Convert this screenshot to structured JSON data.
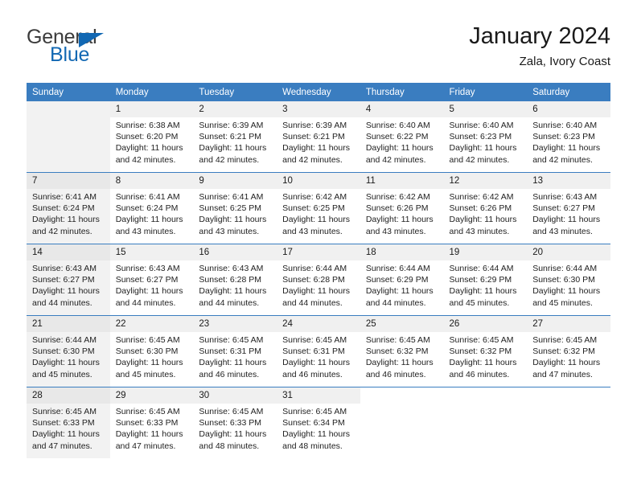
{
  "brand": {
    "name_part1": "General",
    "name_part2": "Blue",
    "triangle_color": "#1268b3",
    "text_color": "#3b3b3b"
  },
  "header": {
    "title": "January 2024",
    "subtitle": "Zala, Ivory Coast"
  },
  "theme": {
    "header_bg": "#3a7dc0",
    "header_text": "#ffffff",
    "daynum_bg": "#f0f0f0",
    "sunday_bg": "#f2f2f2",
    "grid_line": "#3a7dc0"
  },
  "weekdays": [
    "Sunday",
    "Monday",
    "Tuesday",
    "Wednesday",
    "Thursday",
    "Friday",
    "Saturday"
  ],
  "weeks": [
    [
      {
        "day": "",
        "sunrise": "",
        "sunset": "",
        "daylight_line1": "",
        "daylight_line2": ""
      },
      {
        "day": "1",
        "sunrise": "Sunrise: 6:38 AM",
        "sunset": "Sunset: 6:20 PM",
        "daylight_line1": "Daylight: 11 hours",
        "daylight_line2": "and 42 minutes."
      },
      {
        "day": "2",
        "sunrise": "Sunrise: 6:39 AM",
        "sunset": "Sunset: 6:21 PM",
        "daylight_line1": "Daylight: 11 hours",
        "daylight_line2": "and 42 minutes."
      },
      {
        "day": "3",
        "sunrise": "Sunrise: 6:39 AM",
        "sunset": "Sunset: 6:21 PM",
        "daylight_line1": "Daylight: 11 hours",
        "daylight_line2": "and 42 minutes."
      },
      {
        "day": "4",
        "sunrise": "Sunrise: 6:40 AM",
        "sunset": "Sunset: 6:22 PM",
        "daylight_line1": "Daylight: 11 hours",
        "daylight_line2": "and 42 minutes."
      },
      {
        "day": "5",
        "sunrise": "Sunrise: 6:40 AM",
        "sunset": "Sunset: 6:23 PM",
        "daylight_line1": "Daylight: 11 hours",
        "daylight_line2": "and 42 minutes."
      },
      {
        "day": "6",
        "sunrise": "Sunrise: 6:40 AM",
        "sunset": "Sunset: 6:23 PM",
        "daylight_line1": "Daylight: 11 hours",
        "daylight_line2": "and 42 minutes."
      }
    ],
    [
      {
        "day": "7",
        "sunrise": "Sunrise: 6:41 AM",
        "sunset": "Sunset: 6:24 PM",
        "daylight_line1": "Daylight: 11 hours",
        "daylight_line2": "and 42 minutes."
      },
      {
        "day": "8",
        "sunrise": "Sunrise: 6:41 AM",
        "sunset": "Sunset: 6:24 PM",
        "daylight_line1": "Daylight: 11 hours",
        "daylight_line2": "and 43 minutes."
      },
      {
        "day": "9",
        "sunrise": "Sunrise: 6:41 AM",
        "sunset": "Sunset: 6:25 PM",
        "daylight_line1": "Daylight: 11 hours",
        "daylight_line2": "and 43 minutes."
      },
      {
        "day": "10",
        "sunrise": "Sunrise: 6:42 AM",
        "sunset": "Sunset: 6:25 PM",
        "daylight_line1": "Daylight: 11 hours",
        "daylight_line2": "and 43 minutes."
      },
      {
        "day": "11",
        "sunrise": "Sunrise: 6:42 AM",
        "sunset": "Sunset: 6:26 PM",
        "daylight_line1": "Daylight: 11 hours",
        "daylight_line2": "and 43 minutes."
      },
      {
        "day": "12",
        "sunrise": "Sunrise: 6:42 AM",
        "sunset": "Sunset: 6:26 PM",
        "daylight_line1": "Daylight: 11 hours",
        "daylight_line2": "and 43 minutes."
      },
      {
        "day": "13",
        "sunrise": "Sunrise: 6:43 AM",
        "sunset": "Sunset: 6:27 PM",
        "daylight_line1": "Daylight: 11 hours",
        "daylight_line2": "and 43 minutes."
      }
    ],
    [
      {
        "day": "14",
        "sunrise": "Sunrise: 6:43 AM",
        "sunset": "Sunset: 6:27 PM",
        "daylight_line1": "Daylight: 11 hours",
        "daylight_line2": "and 44 minutes."
      },
      {
        "day": "15",
        "sunrise": "Sunrise: 6:43 AM",
        "sunset": "Sunset: 6:27 PM",
        "daylight_line1": "Daylight: 11 hours",
        "daylight_line2": "and 44 minutes."
      },
      {
        "day": "16",
        "sunrise": "Sunrise: 6:43 AM",
        "sunset": "Sunset: 6:28 PM",
        "daylight_line1": "Daylight: 11 hours",
        "daylight_line2": "and 44 minutes."
      },
      {
        "day": "17",
        "sunrise": "Sunrise: 6:44 AM",
        "sunset": "Sunset: 6:28 PM",
        "daylight_line1": "Daylight: 11 hours",
        "daylight_line2": "and 44 minutes."
      },
      {
        "day": "18",
        "sunrise": "Sunrise: 6:44 AM",
        "sunset": "Sunset: 6:29 PM",
        "daylight_line1": "Daylight: 11 hours",
        "daylight_line2": "and 44 minutes."
      },
      {
        "day": "19",
        "sunrise": "Sunrise: 6:44 AM",
        "sunset": "Sunset: 6:29 PM",
        "daylight_line1": "Daylight: 11 hours",
        "daylight_line2": "and 45 minutes."
      },
      {
        "day": "20",
        "sunrise": "Sunrise: 6:44 AM",
        "sunset": "Sunset: 6:30 PM",
        "daylight_line1": "Daylight: 11 hours",
        "daylight_line2": "and 45 minutes."
      }
    ],
    [
      {
        "day": "21",
        "sunrise": "Sunrise: 6:44 AM",
        "sunset": "Sunset: 6:30 PM",
        "daylight_line1": "Daylight: 11 hours",
        "daylight_line2": "and 45 minutes."
      },
      {
        "day": "22",
        "sunrise": "Sunrise: 6:45 AM",
        "sunset": "Sunset: 6:30 PM",
        "daylight_line1": "Daylight: 11 hours",
        "daylight_line2": "and 45 minutes."
      },
      {
        "day": "23",
        "sunrise": "Sunrise: 6:45 AM",
        "sunset": "Sunset: 6:31 PM",
        "daylight_line1": "Daylight: 11 hours",
        "daylight_line2": "and 46 minutes."
      },
      {
        "day": "24",
        "sunrise": "Sunrise: 6:45 AM",
        "sunset": "Sunset: 6:31 PM",
        "daylight_line1": "Daylight: 11 hours",
        "daylight_line2": "and 46 minutes."
      },
      {
        "day": "25",
        "sunrise": "Sunrise: 6:45 AM",
        "sunset": "Sunset: 6:32 PM",
        "daylight_line1": "Daylight: 11 hours",
        "daylight_line2": "and 46 minutes."
      },
      {
        "day": "26",
        "sunrise": "Sunrise: 6:45 AM",
        "sunset": "Sunset: 6:32 PM",
        "daylight_line1": "Daylight: 11 hours",
        "daylight_line2": "and 46 minutes."
      },
      {
        "day": "27",
        "sunrise": "Sunrise: 6:45 AM",
        "sunset": "Sunset: 6:32 PM",
        "daylight_line1": "Daylight: 11 hours",
        "daylight_line2": "and 47 minutes."
      }
    ],
    [
      {
        "day": "28",
        "sunrise": "Sunrise: 6:45 AM",
        "sunset": "Sunset: 6:33 PM",
        "daylight_line1": "Daylight: 11 hours",
        "daylight_line2": "and 47 minutes."
      },
      {
        "day": "29",
        "sunrise": "Sunrise: 6:45 AM",
        "sunset": "Sunset: 6:33 PM",
        "daylight_line1": "Daylight: 11 hours",
        "daylight_line2": "and 47 minutes."
      },
      {
        "day": "30",
        "sunrise": "Sunrise: 6:45 AM",
        "sunset": "Sunset: 6:33 PM",
        "daylight_line1": "Daylight: 11 hours",
        "daylight_line2": "and 48 minutes."
      },
      {
        "day": "31",
        "sunrise": "Sunrise: 6:45 AM",
        "sunset": "Sunset: 6:34 PM",
        "daylight_line1": "Daylight: 11 hours",
        "daylight_line2": "and 48 minutes."
      },
      {
        "day": "",
        "sunrise": "",
        "sunset": "",
        "daylight_line1": "",
        "daylight_line2": ""
      },
      {
        "day": "",
        "sunrise": "",
        "sunset": "",
        "daylight_line1": "",
        "daylight_line2": ""
      },
      {
        "day": "",
        "sunrise": "",
        "sunset": "",
        "daylight_line1": "",
        "daylight_line2": ""
      }
    ]
  ]
}
